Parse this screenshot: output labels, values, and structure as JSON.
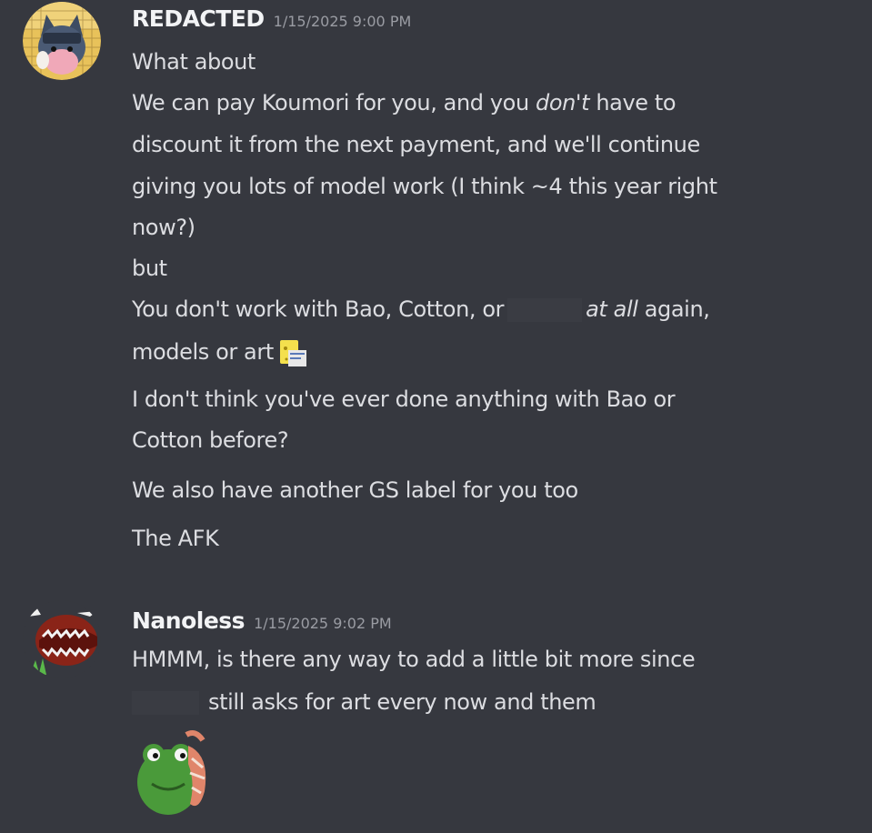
{
  "messages": [
    {
      "username": "REDACTED",
      "timestamp": "1/15/2025 9:00 PM",
      "lines": {
        "l1": "What about",
        "l2a": "We can pay Koumori for you, and you ",
        "l2b": "don't",
        "l2c": " have to",
        "l3": "discount it from the next payment, and we'll continue",
        "l4": "giving you lots of model work (I think ~4 this year right",
        "l5": "now?)",
        "l6": "but",
        "l7a": "You don't work with Bao, Cotton, or",
        "l7b": "at all",
        "l7c": " again,",
        "l8": "models or art",
        "l9": "I don't think you've ever done anything with Bao or",
        "l10": "Cotton before?",
        "l11": "We also have another GS label for you too",
        "l12": "The AFK"
      },
      "avatar_icon": "cat-avatar-icon",
      "inline_emoji": "spongebob-emoji-icon"
    },
    {
      "username": "Nanoless",
      "timestamp": "1/15/2025 9:02 PM",
      "lines": {
        "l1": "HMMM, is there any way to add a little bit more since",
        "l2": "still asks for art every now and them"
      },
      "avatar_icon": "shark-avatar-icon",
      "sticker": "frog-sticker-icon"
    }
  ],
  "colors": {
    "background": "#36383f",
    "text": "#dcdde1",
    "username": "#f2f3f5",
    "timestamp": "#9a9ca3"
  }
}
